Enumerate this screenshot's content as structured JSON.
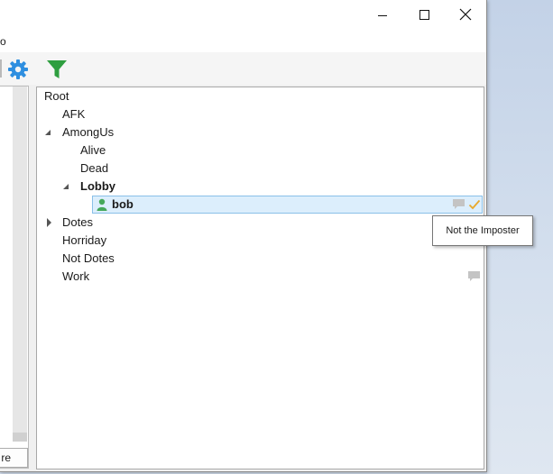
{
  "menubar": {
    "partial_item": "o"
  },
  "toolbar": {
    "settings_icon": "gear-icon",
    "filter_icon": "filter-icon"
  },
  "left_panel": {
    "button_partial_label": "re"
  },
  "tree": {
    "root": "Root",
    "channels": {
      "afk": "AFK",
      "amongus": "AmongUs",
      "alive": "Alive",
      "dead": "Dead",
      "lobby": "Lobby",
      "dotes": "Dotes",
      "horriday": "Horriday",
      "not_dotes": "Not Dotes",
      "work": "Work"
    },
    "users": {
      "bob": "bob"
    }
  },
  "tooltip": {
    "text": "Not the Imposter"
  },
  "colors": {
    "gear": "#2f8fe0",
    "filter": "#2e9e3f",
    "user": "#45a85a",
    "check": "#e8a92c",
    "selection": "#dceefc"
  }
}
